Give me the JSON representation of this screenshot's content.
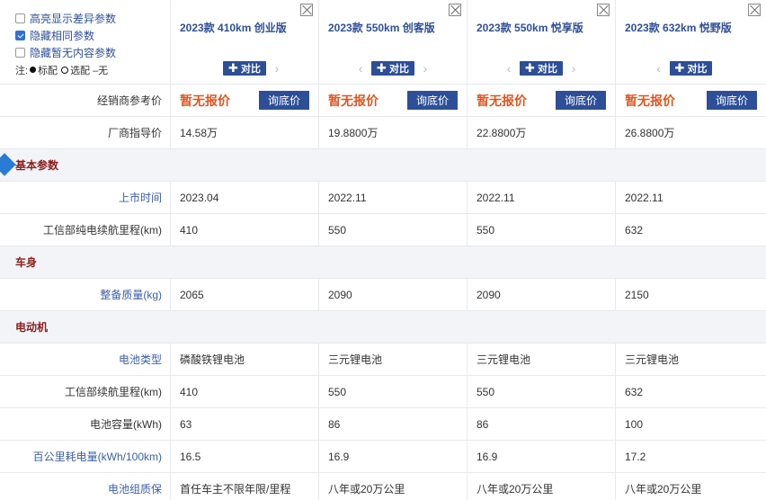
{
  "options": {
    "highlight_diff": "高亮显示差异参数",
    "hide_same": "隐藏相同参数",
    "hide_empty": "隐藏暂无内容参数",
    "legend_prefix": "注:",
    "legend_standard": "标配",
    "legend_optional": "选配",
    "legend_none": "–无"
  },
  "compare_label": "对比",
  "ask_price_label": "询底价",
  "no_price_label": "暂无报价",
  "cars": [
    {
      "name": "2023款 410km 创业版",
      "guide_price": "14.58万",
      "launch": "2023.04",
      "range": "410",
      "weight": "2065",
      "battery_type": "磷酸铁锂电池",
      "motor_range": "410",
      "battery_kwh": "63",
      "consumption": "16.5",
      "warranty": "首任车主不限年限/里程"
    },
    {
      "name": "2023款 550km 创客版",
      "guide_price": "19.8800万",
      "launch": "2022.11",
      "range": "550",
      "weight": "2090",
      "battery_type": "三元锂电池",
      "motor_range": "550",
      "battery_kwh": "86",
      "consumption": "16.9",
      "warranty": "八年或20万公里"
    },
    {
      "name": "2023款 550km 悦享版",
      "guide_price": "22.8800万",
      "launch": "2022.11",
      "range": "550",
      "weight": "2090",
      "battery_type": "三元锂电池",
      "motor_range": "550",
      "battery_kwh": "86",
      "consumption": "16.9",
      "warranty": "八年或20万公里"
    },
    {
      "name": "2023款 632km 悦野版",
      "guide_price": "26.8800万",
      "launch": "2022.11",
      "range": "632",
      "weight": "2150",
      "battery_type": "三元锂电池",
      "motor_range": "632",
      "battery_kwh": "100",
      "consumption": "17.2",
      "warranty": "八年或20万公里"
    }
  ],
  "labels": {
    "dealer_price": "经销商参考价",
    "guide_price": "厂商指导价",
    "launch": "上市时间",
    "range": "工信部纯电续航里程(km)",
    "weight": "整备质量(kg)",
    "battery_type": "电池类型",
    "motor_range": "工信部续航里程(km)",
    "battery_kwh": "电池容量(kWh)",
    "consumption": "百公里耗电量(kWh/100km)",
    "warranty": "电池组质保"
  },
  "sections": {
    "basic": "基本参数",
    "body": "车身",
    "motor": "电动机"
  },
  "colors": {
    "accent": "#2d4f98",
    "price": "#e2541e",
    "section_title": "#8a1d1d"
  }
}
